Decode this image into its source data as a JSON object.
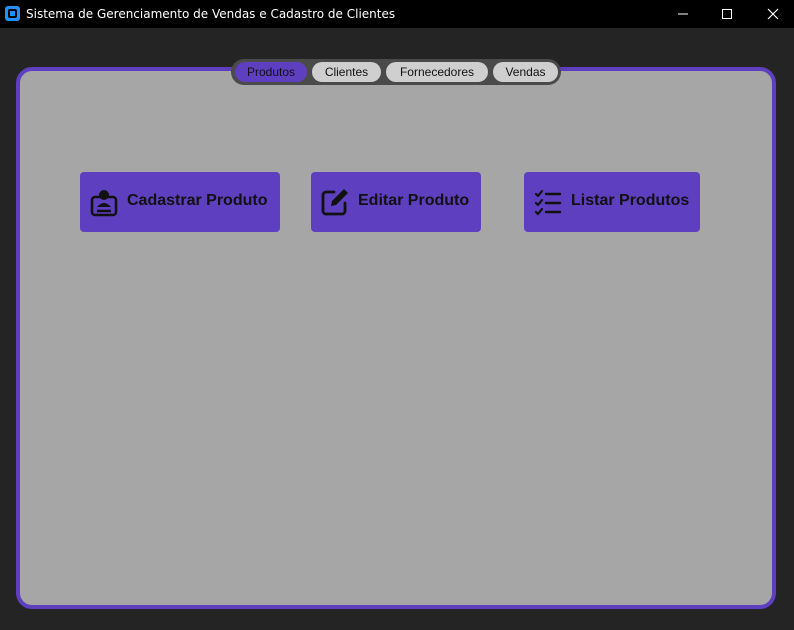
{
  "window": {
    "title": "Sistema de Gerenciamento de Vendas e Cadastro de Clientes",
    "app_icon": "app-window-icon",
    "controls": [
      "minimize-icon",
      "maximize-icon",
      "close-icon"
    ]
  },
  "tabs": [
    {
      "label": "Produtos",
      "active": true
    },
    {
      "label": "Clientes",
      "active": false
    },
    {
      "label": "Fornecedores",
      "active": false
    },
    {
      "label": "Vendas",
      "active": false
    }
  ],
  "actions": [
    {
      "label": "Cadastrar Produto",
      "icon": "register-product-icon"
    },
    {
      "label": "Editar Produto",
      "icon": "edit-icon"
    },
    {
      "label": "Listar Produtos",
      "icon": "list-checks-icon"
    }
  ],
  "colors": {
    "accent": "#5e3fbf",
    "panel_bg": "#a6a6a6",
    "window_bg": "#242424",
    "titlebar_bg": "#000000",
    "tab_inactive": "#cfcfcf"
  }
}
